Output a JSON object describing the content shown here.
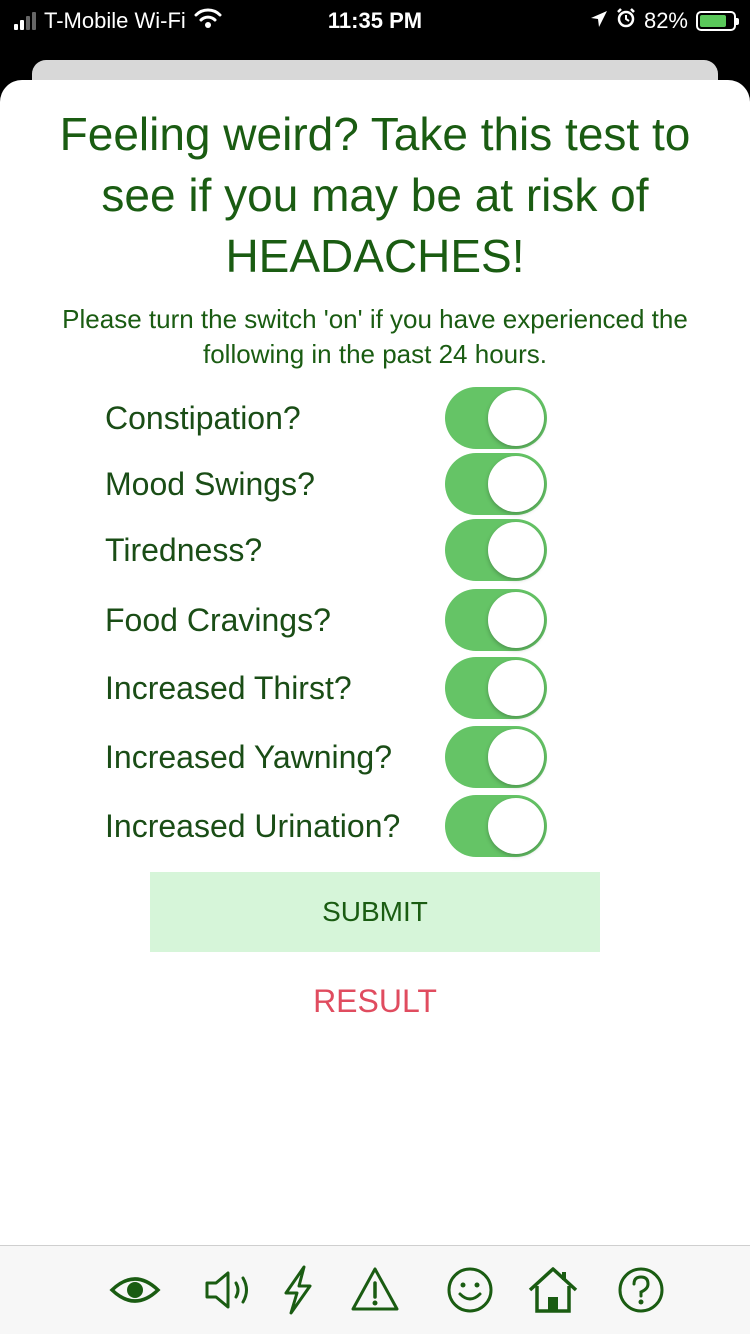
{
  "status_bar": {
    "carrier": "T-Mobile Wi-Fi",
    "time": "11:35 PM",
    "battery": "82%"
  },
  "page": {
    "title": "Feeling weird? Take this test to see if you may be at risk of HEADACHES!",
    "subtitle": "Please turn the switch 'on' if you have experienced the following in the past 24 hours."
  },
  "symptoms": [
    {
      "label": "Constipation?",
      "on": true
    },
    {
      "label": "Mood Swings?",
      "on": true
    },
    {
      "label": "Tiredness?",
      "on": true
    },
    {
      "label": "Food Cravings?",
      "on": true
    },
    {
      "label": "Increased Thirst?",
      "on": true
    },
    {
      "label": "Increased Yawning?",
      "on": true
    },
    {
      "label": "Increased Urination?",
      "on": true
    }
  ],
  "actions": {
    "submit_label": "SUBMIT",
    "result_label": "RESULT"
  },
  "tabbar": {
    "icons": [
      "eye-icon",
      "speaker-icon",
      "lightning-icon",
      "warning-icon",
      "smiley-icon",
      "home-icon",
      "question-icon"
    ]
  },
  "colors": {
    "title_green": "#1a5c12",
    "toggle_on": "#65c466",
    "submit_bg": "#d6f5d9",
    "result_red": "#e04c5f"
  }
}
